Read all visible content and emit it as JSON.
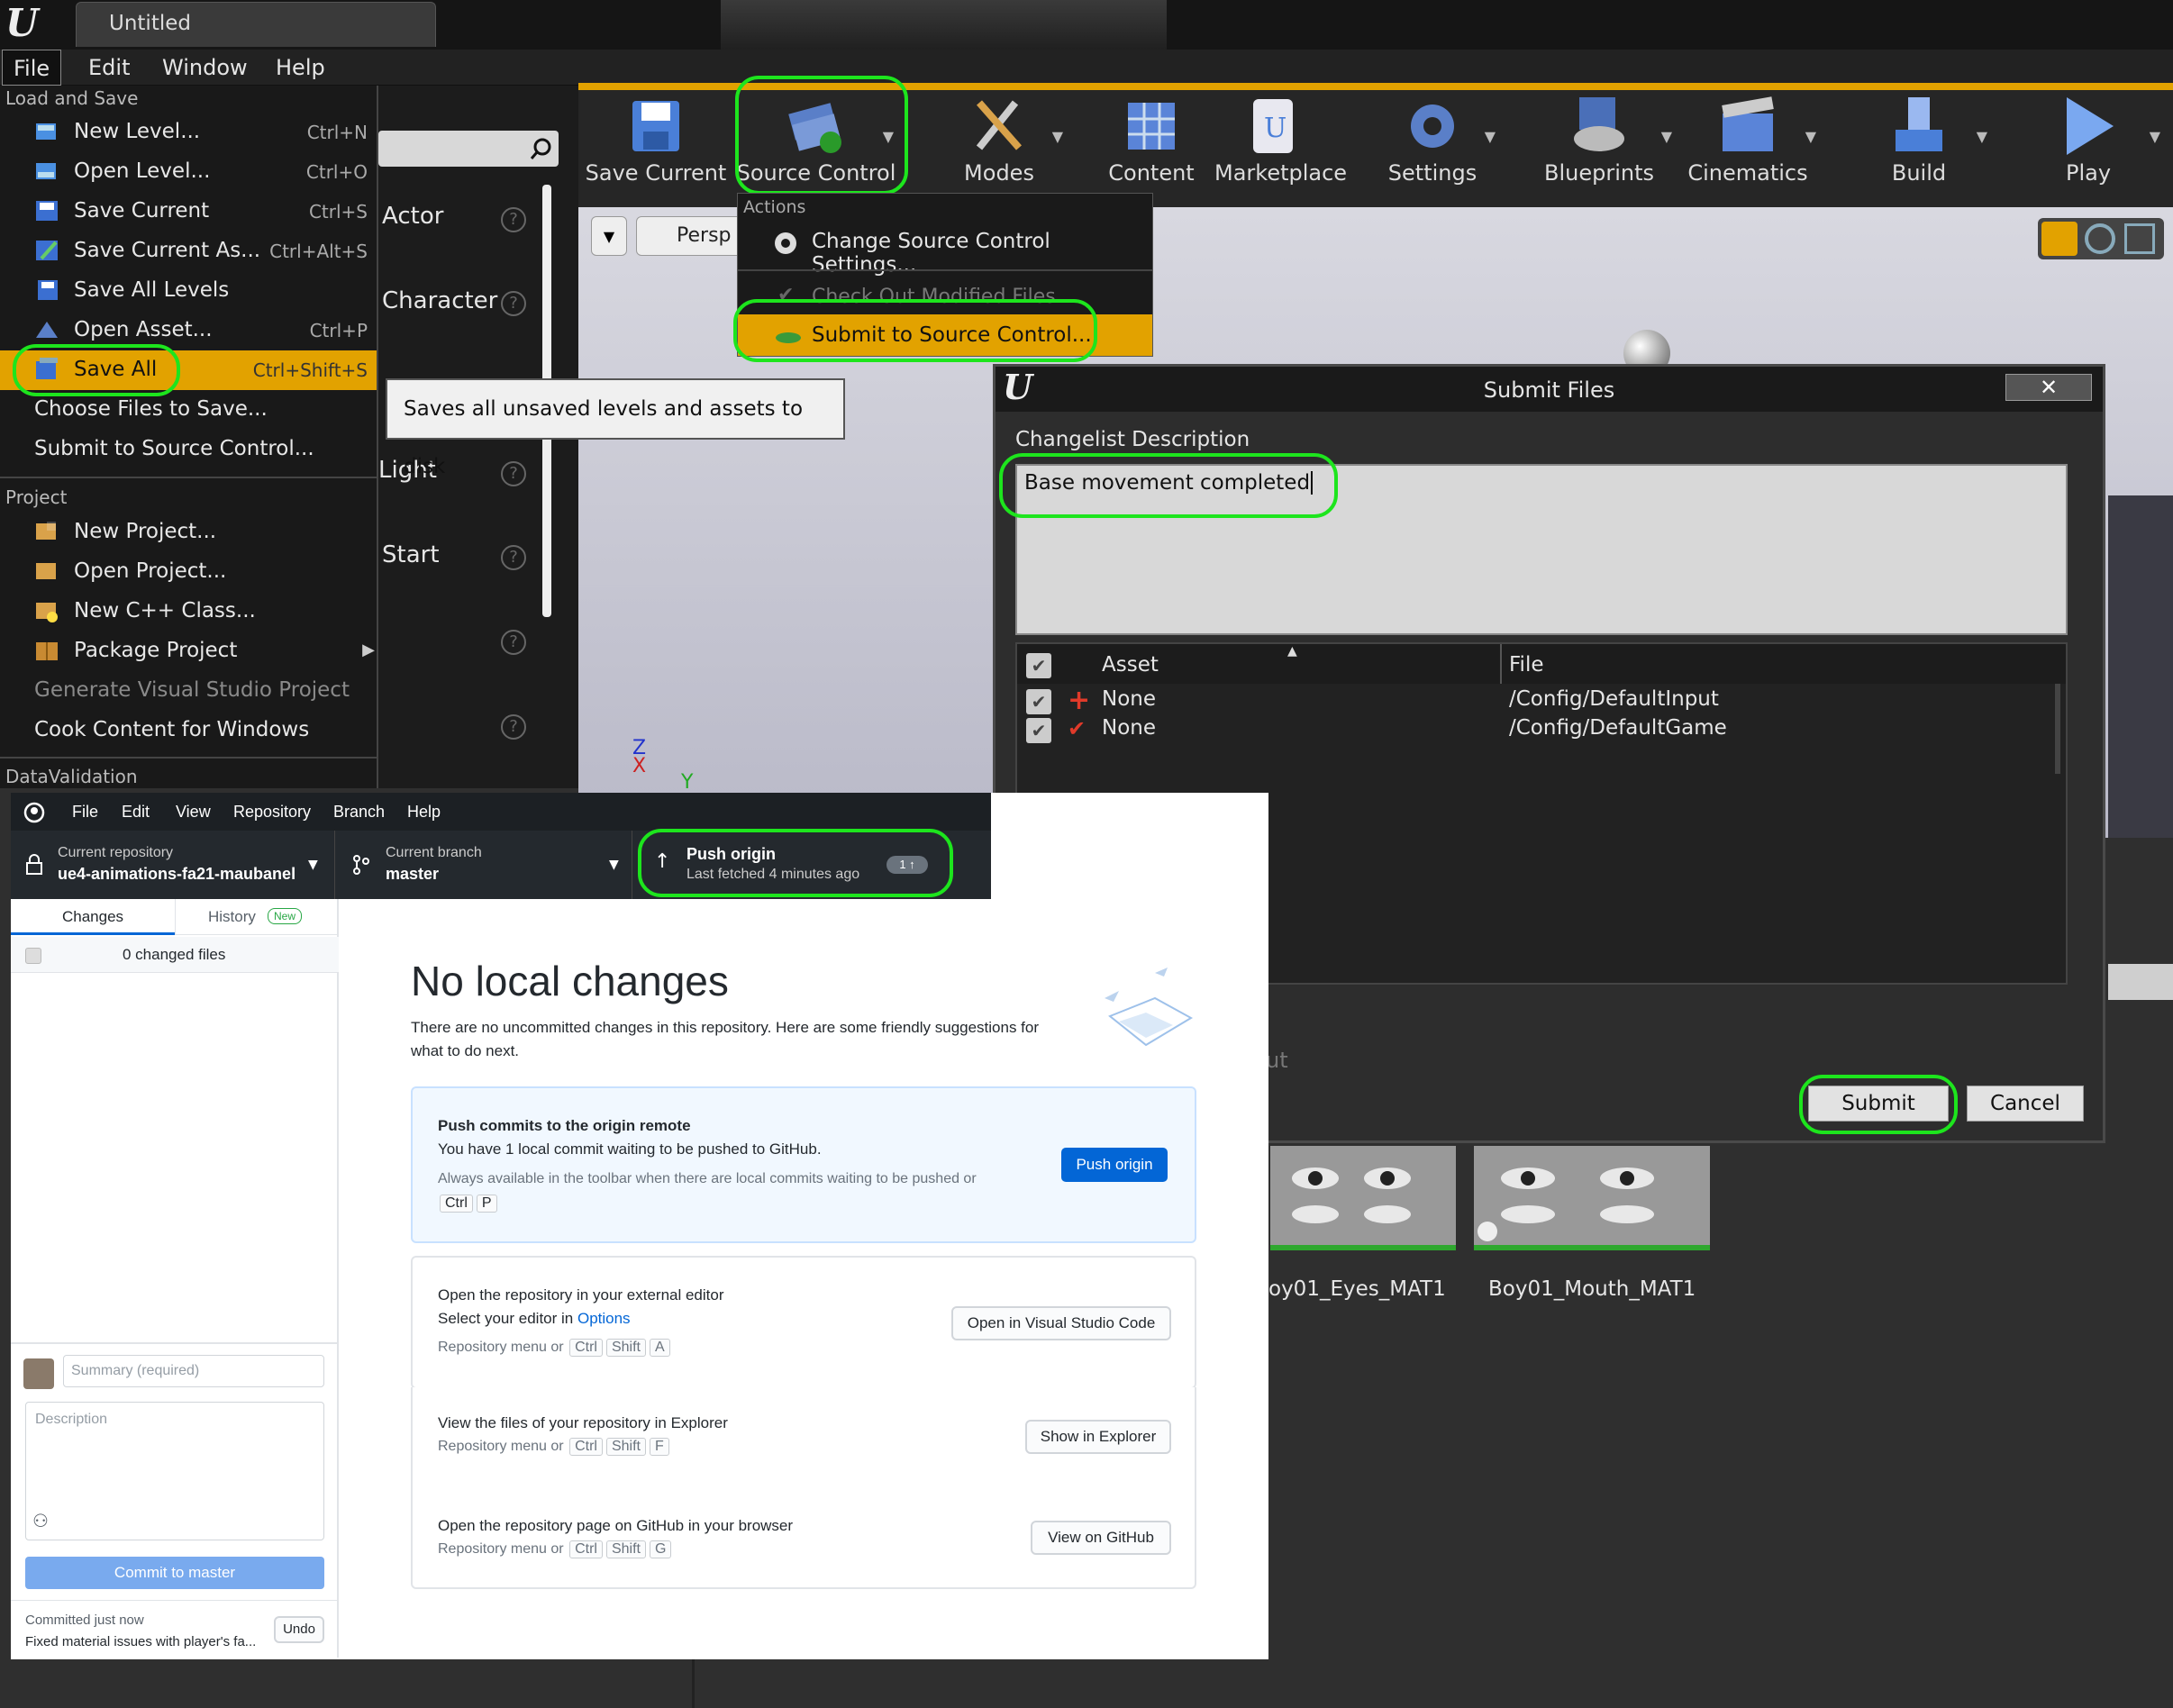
{
  "ue": {
    "tab_title": "Untitled",
    "menu": [
      "File",
      "Edit",
      "Window",
      "Help"
    ],
    "file_menu": {
      "load_save_header": "Load and Save",
      "items": [
        {
          "label": "New Level...",
          "shortcut": "Ctrl+N"
        },
        {
          "label": "Open Level...",
          "shortcut": "Ctrl+O"
        },
        {
          "label": "Save Current",
          "shortcut": "Ctrl+S"
        },
        {
          "label": "Save Current As...",
          "shortcut": "Ctrl+Alt+S"
        },
        {
          "label": "Save All Levels",
          "shortcut": ""
        },
        {
          "label": "Open Asset...",
          "shortcut": "Ctrl+P"
        },
        {
          "label": "Save All",
          "shortcut": "Ctrl+Shift+S"
        },
        {
          "label": "Choose Files to Save...",
          "shortcut": ""
        },
        {
          "label": "Submit to Source Control...",
          "shortcut": ""
        }
      ],
      "project_header": "Project",
      "project_items": [
        "New Project...",
        "Open Project...",
        "New C++ Class...",
        "Package Project",
        "Generate Visual Studio Project",
        "Cook Content for Windows"
      ],
      "datavalidation_header": "DataValidation"
    },
    "tooltip": "Saves all unsaved levels and assets to disk",
    "place_panel": [
      "Actor",
      "Character",
      "Light",
      "Start"
    ],
    "toolbar": [
      "Save Current",
      "Source Control",
      "Modes",
      "Content",
      "Marketplace",
      "Settings",
      "Blueprints",
      "Cinematics",
      "Build",
      "Play"
    ],
    "viewport_label": "Persp",
    "source_menu": {
      "header": "Actions",
      "change_settings": "Change Source Control Settings...",
      "check_out": "Check Out Modified Files",
      "submit": "Submit to Source Control..."
    },
    "dialog": {
      "title": "Submit Files",
      "desc_label": "Changelist Description",
      "desc_value": "Base movement completed",
      "col_asset": "Asset",
      "col_file": "File",
      "rows": [
        {
          "asset": "None",
          "file": "/Config/DefaultInput"
        },
        {
          "asset": "None",
          "file": "/Config/DefaultGame"
        }
      ],
      "submit": "Submit",
      "cancel": "Cancel",
      "behind": "ut"
    },
    "assets": [
      "oy01_Eyes_MAT1",
      "Boy01_Mouth_MAT1"
    ]
  },
  "gh": {
    "menu": [
      "File",
      "Edit",
      "View",
      "Repository",
      "Branch",
      "Help"
    ],
    "repo_label": "Current repository",
    "repo_value": "ue4-animations-fa21-maubanel",
    "branch_label": "Current branch",
    "branch_value": "master",
    "push_label": "Push origin",
    "push_sub": "Last fetched 4 minutes ago",
    "push_badge": "1 ↑",
    "tab_changes": "Changes",
    "tab_history": "History",
    "history_badge": "New",
    "changed_files": "0 changed files",
    "summary_placeholder": "Summary (required)",
    "description_placeholder": "Description",
    "commit_btn": "Commit to master",
    "committed_time": "Committed just now",
    "committed_msg": "Fixed material issues with player's fa...",
    "undo": "Undo",
    "heading": "No local changes",
    "intro": "There are no uncommitted changes in this repository. Here are some friendly suggestions for what to do next.",
    "card1": {
      "title": "Push commits to the origin remote",
      "line1": "You have 1 local commit waiting to be pushed to GitHub.",
      "line2": "Always available in the toolbar when there are local commits waiting to be pushed or",
      "keys": [
        "Ctrl",
        "P"
      ],
      "btn": "Push origin"
    },
    "card2": {
      "title": "Open the repository in your external editor",
      "line1": "Select your editor in ",
      "link": "Options",
      "line2": "Repository menu or",
      "keys": [
        "Ctrl",
        "Shift",
        "A"
      ],
      "btn": "Open in Visual Studio Code"
    },
    "card3": {
      "title": "View the files of your repository in Explorer",
      "line2": "Repository menu or",
      "keys": [
        "Ctrl",
        "Shift",
        "F"
      ],
      "btn": "Show in Explorer"
    },
    "card4": {
      "title": "Open the repository page on GitHub in your browser",
      "line2": "Repository menu or",
      "keys": [
        "Ctrl",
        "Shift",
        "G"
      ],
      "btn": "View on GitHub"
    }
  },
  "colors": {
    "highlight": "#1de51d",
    "ue_select": "#e2a200",
    "gh_blue": "#0366d6"
  }
}
